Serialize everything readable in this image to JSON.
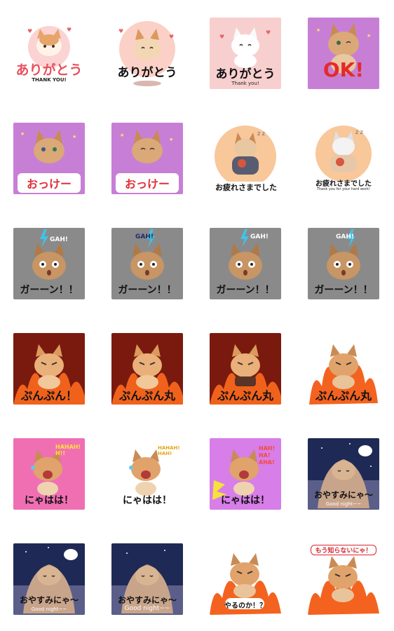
{
  "stickers": [
    {
      "caption": "ありがとう",
      "sub": "THANK YOU!"
    },
    {
      "caption": "ありがとう"
    },
    {
      "caption": "ありがとう",
      "sub": "Thank you!"
    },
    {
      "caption": "OK!"
    },
    {
      "caption": "おっけー"
    },
    {
      "caption": "おっけー"
    },
    {
      "caption": "お疲れさまでした"
    },
    {
      "caption": "お疲れさまでした",
      "sub": "Thank you for your hard work!"
    },
    {
      "caption": "ガーーン！！",
      "fx": "GAH!"
    },
    {
      "caption": "ガーーン！！",
      "fx": "GAH!"
    },
    {
      "caption": "ガーーン！！",
      "fx": "GAH!"
    },
    {
      "caption": "ガーーン！！",
      "fx": "GAH!"
    },
    {
      "caption": "ぷんぷん！"
    },
    {
      "caption": "ぷんぷん丸"
    },
    {
      "caption": "ぷんぷん丸"
    },
    {
      "caption": "ぷんぷん丸"
    },
    {
      "caption": "にゃはは！",
      "fx": "HAHAH! H!!"
    },
    {
      "caption": "にゃはは！",
      "fx": "HAHAH! HAH!"
    },
    {
      "caption": "にゃはは！",
      "fx": "HAH! HA! AHA!"
    },
    {
      "caption": "おやすみにゃ〜",
      "sub": "Good night~~"
    },
    {
      "caption": "おやすみにゃ〜",
      "sub": "Good night~~"
    },
    {
      "caption": "おやすみにゃ〜",
      "sub": "Good night~~"
    },
    {
      "caption": "やるのか！？"
    },
    {
      "caption": "もう知らないにゃ！"
    }
  ]
}
